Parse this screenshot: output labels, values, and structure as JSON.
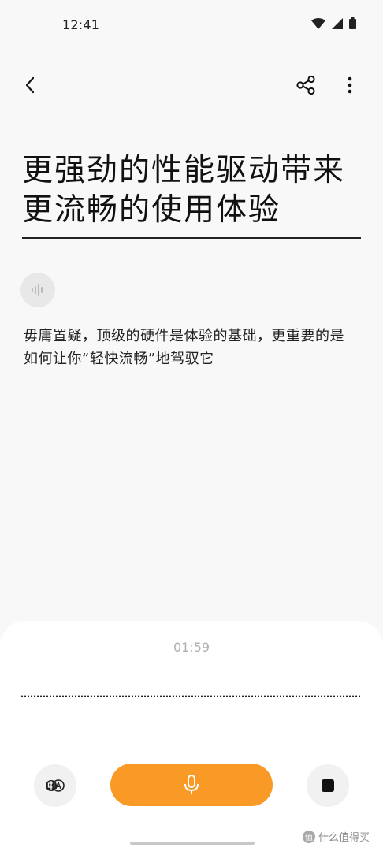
{
  "status_bar": {
    "time": "12:41",
    "icons": [
      "wifi-icon",
      "signal-icon",
      "battery-icon"
    ]
  },
  "toolbar": {
    "back_icon": "back-arrow-icon",
    "share_icon": "share-icon",
    "more_icon": "more-vertical-icon"
  },
  "note": {
    "title": "更强劲的性能驱动带来更流畅的使用体验",
    "body": "毋庸置疑，顶级的硬件是体验的基础，更重要的是如何让你“轻快流畅”地驾驭它"
  },
  "recorder": {
    "timer": "01:59",
    "translate_icon": "translate-icon",
    "record_icon": "microphone-icon",
    "stop_icon": "stop-icon",
    "accent_color": "#f89a25"
  },
  "watermark": {
    "text": "什么值得买",
    "logo": "值"
  }
}
